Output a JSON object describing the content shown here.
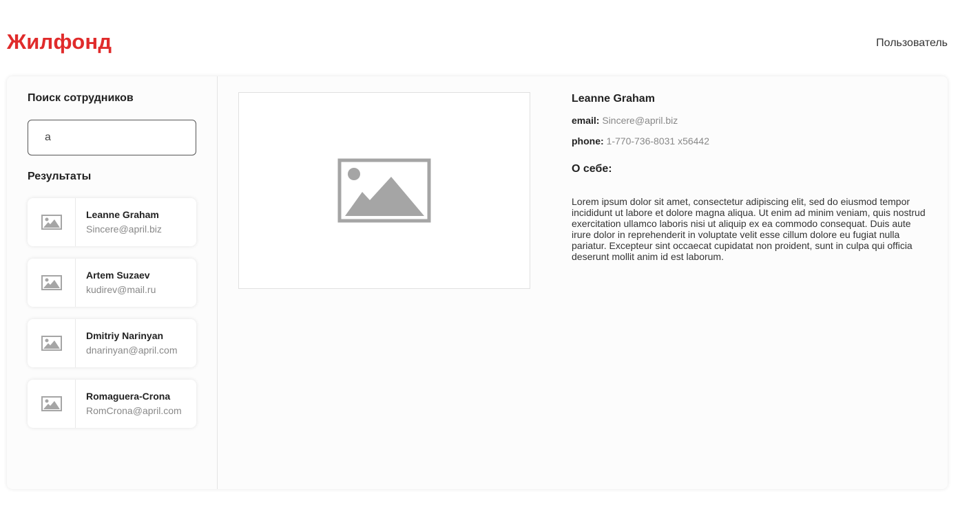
{
  "header": {
    "logo": "Жилфонд",
    "user_label": "Пользователь"
  },
  "sidebar": {
    "search_title": "Поиск сотрудников",
    "search_value": "a",
    "results_title": "Результаты",
    "results": [
      {
        "name": "Leanne Graham",
        "email": "Sincere@april.biz"
      },
      {
        "name": "Artem Suzaev",
        "email": "kudirev@mail.ru"
      },
      {
        "name": "Dmitriy Narinyan",
        "email": "dnarinyan@april.com"
      },
      {
        "name": "Romaguera-Crona",
        "email": "RomCrona@april.com"
      }
    ]
  },
  "details": {
    "name": "Leanne Graham",
    "email_label": "email:",
    "email": "Sincere@april.biz",
    "phone_label": "phone:",
    "phone": "1-770-736-8031 x56442",
    "about_title": "О себе:",
    "about_text": "Lorem ipsum dolor sit amet, consectetur adipiscing elit, sed do eiusmod tempor incididunt ut labore et dolore magna aliqua. Ut enim ad minim veniam, quis nostrud exercitation ullamco laboris nisi ut aliquip ex ea commodo consequat. Duis aute irure dolor in reprehenderit in voluptate velit esse cillum dolore eu fugiat nulla pariatur. Excepteur sint occaecat cupidatat non proident, sunt in culpa qui officia deserunt mollit anim id est laborum."
  },
  "icons": {
    "thumbnail": "image-placeholder-icon",
    "photo": "image-placeholder-icon"
  },
  "colors": {
    "brand": "#e02b2b",
    "placeholder_gray": "#a5a5a5"
  }
}
